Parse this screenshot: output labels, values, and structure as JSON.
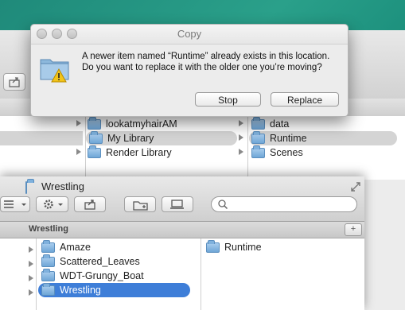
{
  "dialog": {
    "title": "Copy",
    "message": "A newer item named “Runtime” already exists in this location. Do you want to replace it with the older one you’re moving?",
    "stop_label": "Stop",
    "replace_label": "Replace"
  },
  "back_window": {
    "column2": [
      {
        "label": "lookatmyhairAM"
      },
      {
        "label": "My Library"
      },
      {
        "label": "Render Library"
      }
    ],
    "column3": [
      {
        "label": "data"
      },
      {
        "label": "Runtime"
      },
      {
        "label": "Scenes"
      }
    ]
  },
  "front_window": {
    "title": "Wrestling",
    "path_label": "Wrestling",
    "column1": [
      {
        "label": "Amaze"
      },
      {
        "label": "Scattered_Leaves"
      },
      {
        "label": "WDT-Grungy_Boat"
      },
      {
        "label": "Wrestling"
      }
    ],
    "column2": [
      {
        "label": "Runtime"
      }
    ]
  },
  "colors": {
    "selection_blue": "#3e7ed8",
    "selection_gray": "#d4d4d4",
    "desktop_teal": "#1f8a7a"
  }
}
